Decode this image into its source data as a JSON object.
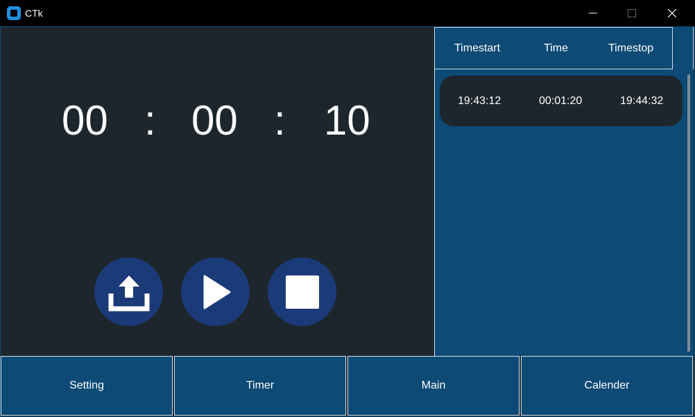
{
  "window": {
    "title": "CTk"
  },
  "timer": {
    "hours": "00",
    "minutes": "00",
    "seconds": "10",
    "separator": ":"
  },
  "controls": {
    "upload": "upload-icon",
    "play": "play-icon",
    "stop": "stop-icon"
  },
  "log": {
    "headers": [
      "Timestart",
      "Time",
      "Timestop"
    ],
    "rows": [
      {
        "start": "19:43:12",
        "time": "00:01:20",
        "stop": "19:44:32"
      }
    ]
  },
  "nav": {
    "items": [
      "Setting",
      "Timer",
      "Main",
      "Calender"
    ]
  },
  "colors": {
    "panel_dark": "#1d262d",
    "panel_blue": "#0d4a75",
    "button_blue": "#1b3a78",
    "accent": "#1f8fe0"
  }
}
